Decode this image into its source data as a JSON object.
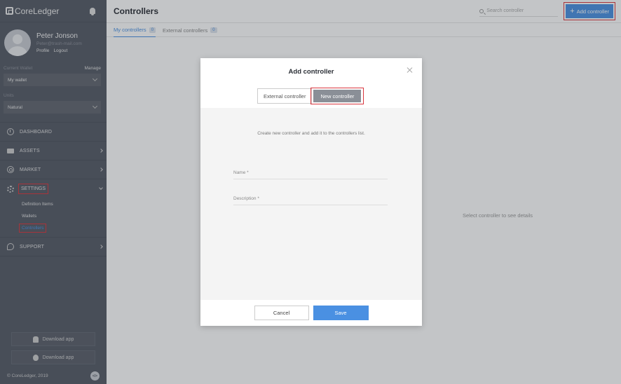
{
  "sidebar": {
    "brand": "CoreLedger",
    "user": {
      "name": "Peter Jonson",
      "email": "Peter@trash-mail.com",
      "profile_link": "Profile",
      "logout_link": "Logout"
    },
    "wallet": {
      "label": "Current Wallet",
      "manage": "Manage",
      "value": "My wallet"
    },
    "units": {
      "label": "Units",
      "value": "Natural"
    },
    "nav": {
      "dashboard": "DASHBOARD",
      "assets": "ASSETS",
      "market": "MARKET",
      "settings": "SETTINGS",
      "settings_children": [
        "Definition Items",
        "Wallets",
        "Controllers"
      ],
      "support": "SUPPORT"
    },
    "download_android": "Download app",
    "download_ios": "Download app",
    "copyright": "© CoreLedger, 2019",
    "code_badge": "</>"
  },
  "main": {
    "title": "Controllers",
    "search_placeholder": "Search controller",
    "add_button": "Add controller",
    "tabs": [
      {
        "label": "My controllers",
        "count": "0"
      },
      {
        "label": "External controllers",
        "count": "0"
      }
    ],
    "empty_message": "Select controller to see details"
  },
  "modal": {
    "title": "Add controller",
    "switch_external": "External controller",
    "switch_new": "New controller",
    "description": "Create new controller and add it to the controllers list.",
    "name_label": "Name *",
    "description_label": "Description *",
    "cancel": "Cancel",
    "save": "Save"
  },
  "colors": {
    "accent": "#4a90e2",
    "highlight": "#d9363e",
    "sidebar": "#555a66"
  }
}
